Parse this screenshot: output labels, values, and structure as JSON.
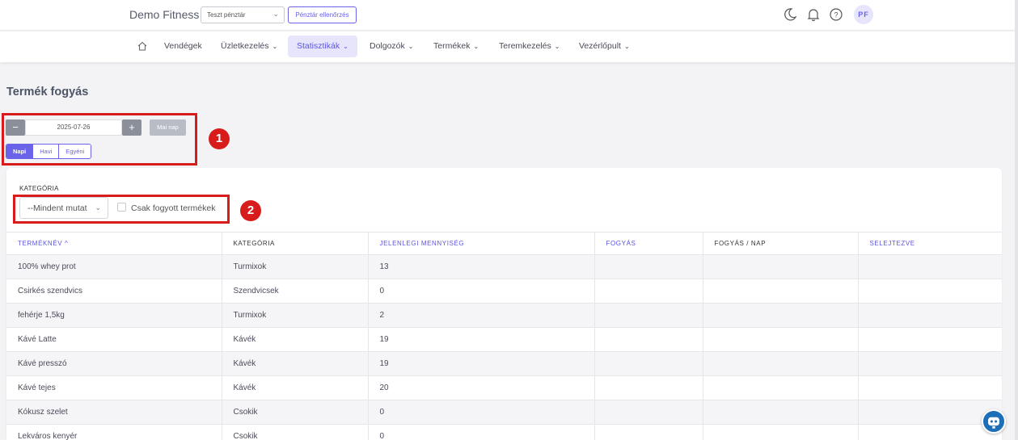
{
  "header": {
    "brand": "Demo Fitness",
    "cash_select": "Teszt pénztár",
    "cash_check_button": "Pénztár ellenőrzés",
    "user_initials": "PF",
    "icons": [
      "moon-icon",
      "bell-icon",
      "help-icon"
    ]
  },
  "nav": {
    "items": [
      {
        "label": "Vendégek",
        "has_caret": false
      },
      {
        "label": "Üzletkezelés",
        "has_caret": true
      },
      {
        "label": "Statisztikák",
        "has_caret": true,
        "active": true
      },
      {
        "label": "Dolgozók",
        "has_caret": true
      },
      {
        "label": "Termékek",
        "has_caret": true
      },
      {
        "label": "Teremkezelés",
        "has_caret": true
      },
      {
        "label": "Vezérlőpult",
        "has_caret": true
      }
    ]
  },
  "page": {
    "title": "Termék fogyás"
  },
  "date_controls": {
    "minus": "−",
    "date": "2025-07-26",
    "plus": "+",
    "today_button": "Mai nap",
    "periods": [
      "Napi",
      "Havi",
      "Egyéni"
    ],
    "active_period": "Napi"
  },
  "annotations": {
    "badge1": "1",
    "badge2": "2"
  },
  "filters": {
    "category_label": "KATEGÓRIA",
    "category_value": "--Mindent mutat",
    "only_sold_label": "Csak fogyott termékek"
  },
  "table": {
    "columns": [
      {
        "label": "TERMÉKNÉV",
        "link": true,
        "sorted": "asc"
      },
      {
        "label": "KATEGÓRIA",
        "link": false
      },
      {
        "label": "JELENLEGI MENNYISÉG",
        "link": true
      },
      {
        "label": "FOGYÁS",
        "link": true
      },
      {
        "label": "FOGYÁS / NAP",
        "link": false
      },
      {
        "label": "SELEJTEZVE",
        "link": true
      }
    ],
    "rows": [
      [
        "100% whey prot",
        "Turmixok",
        "13",
        "",
        "",
        ""
      ],
      [
        "Csirkés szendvics",
        "Szendvicsek",
        "0",
        "",
        "",
        ""
      ],
      [
        "fehérje 1,5kg",
        "Turmixok",
        "2",
        "",
        "",
        ""
      ],
      [
        "Kávé Latte",
        "Kávék",
        "19",
        "",
        "",
        ""
      ],
      [
        "Kávé presszó",
        "Kávék",
        "19",
        "",
        "",
        ""
      ],
      [
        "Kávé tejes",
        "Kávék",
        "20",
        "",
        "",
        ""
      ],
      [
        "Kókusz szelet",
        "Csokik",
        "0",
        "",
        "",
        ""
      ],
      [
        "Lekváros kenyér",
        "Csokik",
        "0",
        "",
        "",
        ""
      ]
    ]
  },
  "colors": {
    "accent": "#6a62e8",
    "annotation_red": "#d81b1b"
  }
}
